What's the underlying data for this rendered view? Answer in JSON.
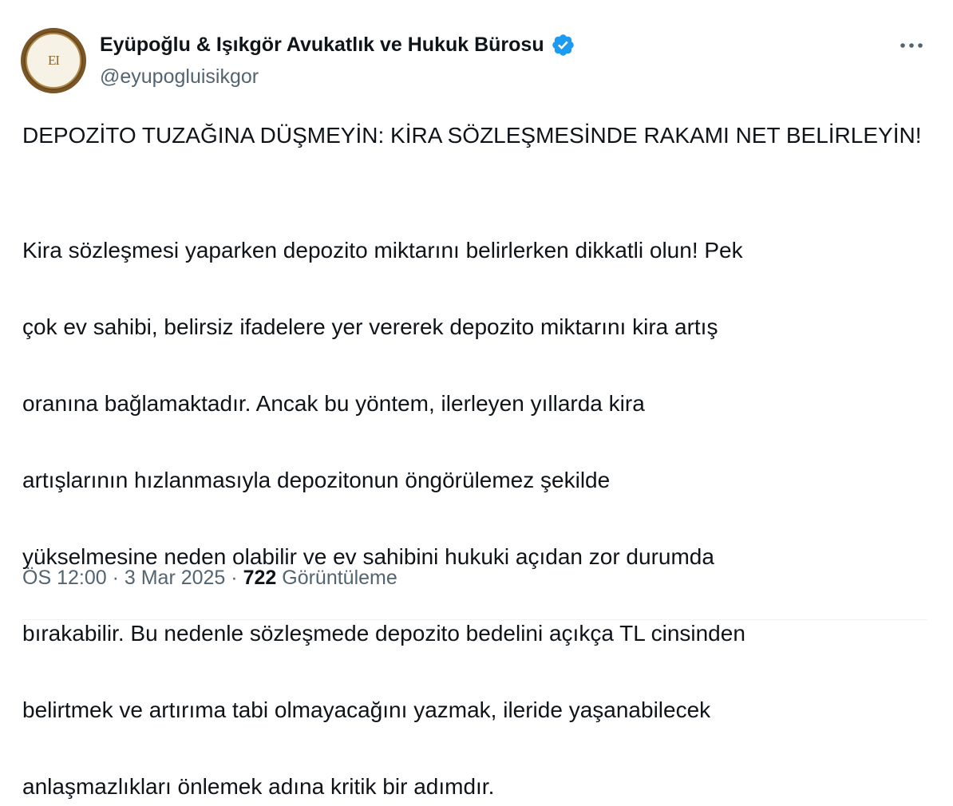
{
  "author": {
    "name": "Eyüpoğlu & Işıkgör Avukatlık ve Hukuk Bürosu",
    "handle": "@eyupogluisikgor",
    "avatar_monogram": "EI",
    "verified": true,
    "verified_icon": "verified-badge-icon",
    "verified_color": "#1d9bf0"
  },
  "menu": {
    "icon": "more-horizontal-icon",
    "glyph": "•••"
  },
  "tweet": {
    "headline": "DEPOZİTO TUZAĞINA DÜŞMEYİN: KİRA SÖZLEŞMESİNDE RAKAMI NET BELİRLEYİN!",
    "body_lines": [
      "Kira sözleşmesi yaparken depozito miktarını belirlerken dikkatli olun! Pek",
      "çok ev sahibi, belirsiz ifadelere yer vererek depozito miktarını kira artış",
      "oranına bağlamaktadır. Ancak bu yöntem, ilerleyen yıllarda kira",
      "artışlarının hızlanmasıyla depozitonun öngörülemez şekilde",
      "yükselmesine neden olabilir ve ev sahibini hukuki açıdan zor durumda",
      "bırakabilir. Bu nedenle sözleşmede depozito bedelini açıkça TL cinsinden",
      "belirtmek ve artırıma tabi olmayacağını yazmak, ileride yaşanabilecek",
      "anlaşmazlıkları önlemek adına kritik bir adımdır."
    ]
  },
  "meta": {
    "time": "ÖS 12:00",
    "separator": "·",
    "date": "3 Mar 2025",
    "views_count": "722",
    "views_label": "Görüntüleme"
  }
}
